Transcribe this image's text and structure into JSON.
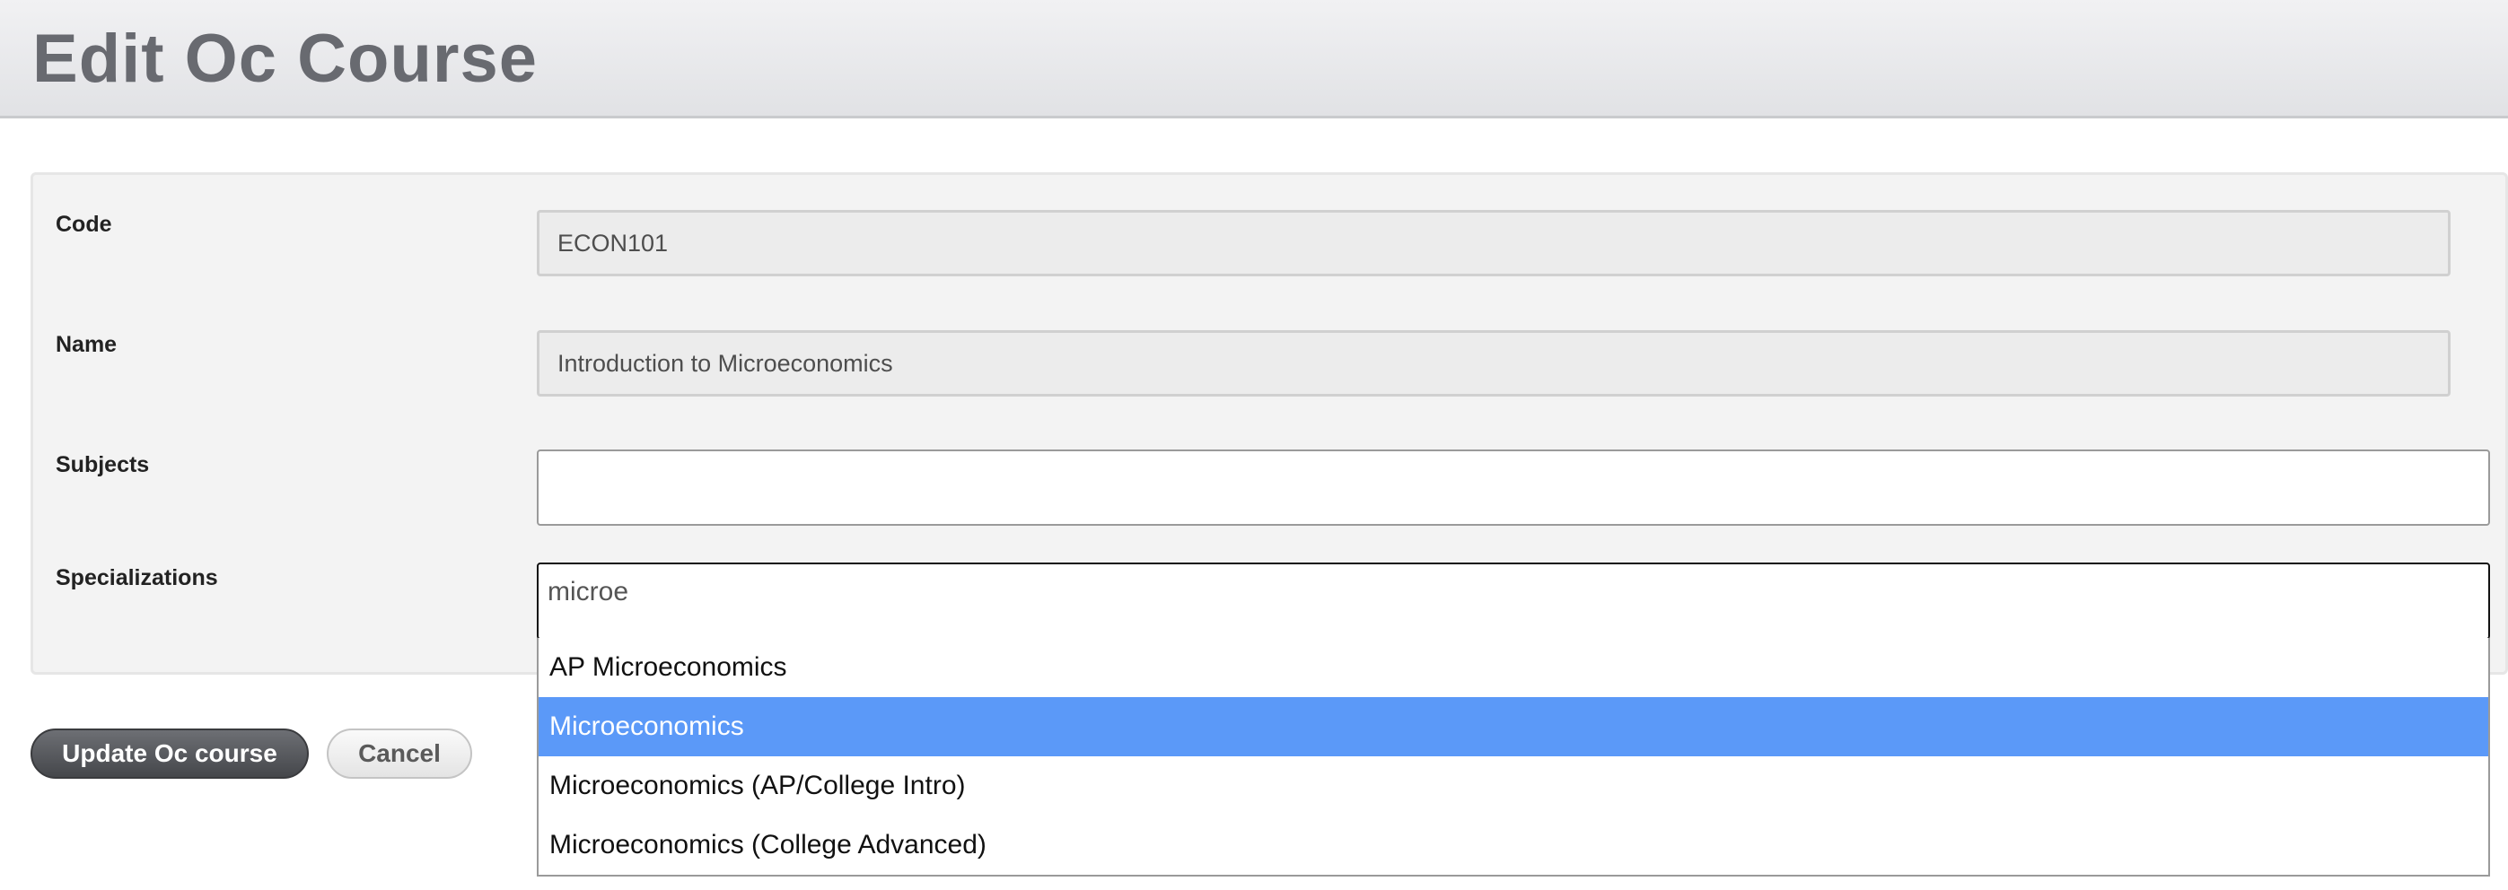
{
  "header": {
    "title": "Edit Oc Course"
  },
  "form": {
    "code": {
      "label": "Code",
      "value": "ECON101"
    },
    "name": {
      "label": "Name",
      "value": "Introduction to Microeconomics"
    },
    "subjects": {
      "label": "Subjects",
      "value": ""
    },
    "specializations": {
      "label": "Specializations",
      "query": "microe",
      "options": [
        {
          "label": "AP Microeconomics",
          "selected": false
        },
        {
          "label": "Microeconomics",
          "selected": true
        },
        {
          "label": "Microeconomics (AP/College Intro)",
          "selected": false
        },
        {
          "label": "Microeconomics (College Advanced)",
          "selected": false
        }
      ]
    }
  },
  "actions": {
    "submit_label": "Update Oc course",
    "cancel_label": "Cancel"
  },
  "colors": {
    "highlight": "#5b99f8",
    "title_text": "#686a70",
    "primary_button": "#55575b"
  }
}
